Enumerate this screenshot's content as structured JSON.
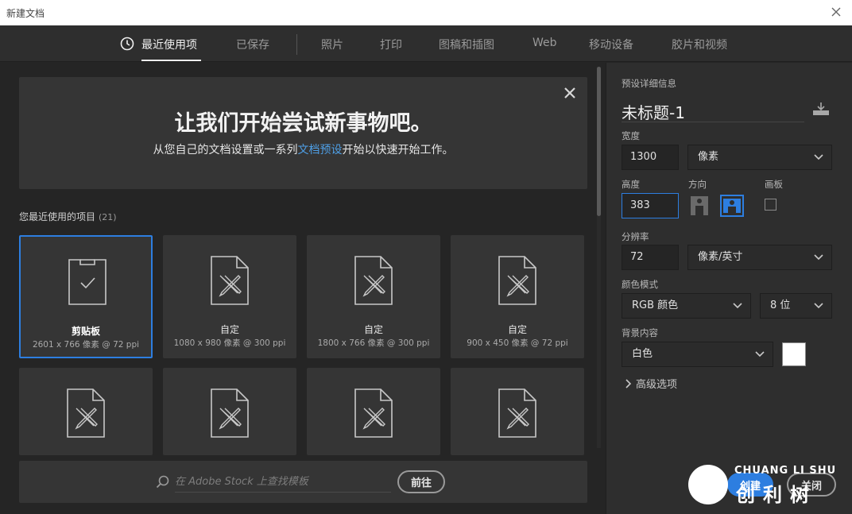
{
  "window": {
    "title": "新建文档"
  },
  "tabs": [
    {
      "label": "最近使用项",
      "active": true
    },
    {
      "label": "已保存"
    },
    {
      "label": "照片"
    },
    {
      "label": "打印"
    },
    {
      "label": "图稿和插图"
    },
    {
      "label": "Web"
    },
    {
      "label": "移动设备"
    },
    {
      "label": "胶片和视频"
    }
  ],
  "hero": {
    "title": "让我们开始尝试新事物吧。",
    "sub_before": "从您自己的文档设置或一系列",
    "sub_link": "文档预设",
    "sub_after": "开始以快速开始工作。"
  },
  "recent": {
    "label": "您最近使用的项目",
    "count": "(21)",
    "items": [
      {
        "name": "剪贴板",
        "meta": "2601 x 766 像素 @ 72 ppi",
        "icon": "clipboard-icon"
      },
      {
        "name": "自定",
        "meta": "1080 x 980 像素 @ 300 ppi",
        "icon": "document-pencil-ruler-icon"
      },
      {
        "name": "自定",
        "meta": "1800 x 766 像素 @ 300 ppi",
        "icon": "document-pencil-ruler-icon"
      },
      {
        "name": "自定",
        "meta": "900 x 450 像素 @ 72 ppi",
        "icon": "document-pencil-ruler-icon"
      }
    ]
  },
  "search": {
    "placeholder": "在 Adobe Stock 上查找模板",
    "go_label": "前往"
  },
  "preset": {
    "section_label": "预设详细信息",
    "doc_name": "未标题-1",
    "width_label": "宽度",
    "width_value": "1300",
    "width_unit": "像素",
    "height_label": "高度",
    "height_value": "383",
    "orientation_label": "方向",
    "artboard_label": "画板",
    "resolution_label": "分辨率",
    "resolution_value": "72",
    "resolution_unit": "像素/英寸",
    "color_mode_label": "颜色模式",
    "color_mode": "RGB 颜色",
    "bit_depth": "8 位",
    "background_label": "背景内容",
    "background": "白色",
    "background_color": "#ffffff",
    "advanced_label": "高级选项",
    "create_label": "创建",
    "close_label": "关闭"
  },
  "watermark": {
    "top": "CHUANG LI SHU",
    "bottom": "创利树"
  },
  "colors": {
    "accent": "#2d7ee0",
    "link": "#4e9fe6",
    "panel": "#353535",
    "background": "#252525"
  }
}
